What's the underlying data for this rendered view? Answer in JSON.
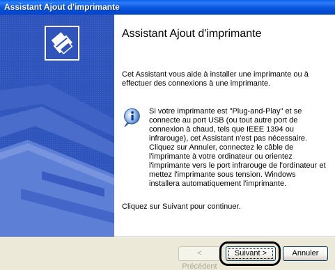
{
  "window": {
    "title": "Assistant Ajout d'imprimante"
  },
  "content": {
    "heading": "Assistant Ajout d'imprimante",
    "intro": "Cet Assistant vous aide à installer une imprimante ou à effectuer des connexions à une imprimante.",
    "info": "Si votre imprimante est \"Plug-and-Play\" et se\nconnecte au port USB (ou tout autre port de\nconnexion à chaud, tels que IEEE 1394 ou\ninfrarouge), cet Assistant n'est pas nécessaire.\nCliquez sur Annuler, connectez le câble de\nl'imprimante à votre ordinateur ou orientez\nl'imprimante vers le port infrarouge de l'ordinateur et\nmettez l'imprimante sous tension. Windows\ninstallera automatiquement l'imprimante.",
    "continue": "Cliquez sur Suivant pour continuer."
  },
  "buttons": {
    "prev": "< Précédent",
    "next": "Suivant >",
    "cancel": "Annuler"
  },
  "colors": {
    "titlebar": "#0955dd",
    "left_panel": "#2f55bd",
    "dialog_bg": "#ece9d8"
  },
  "icons": {
    "wizard": "printer-wizard-icon",
    "info": "info-icon"
  }
}
